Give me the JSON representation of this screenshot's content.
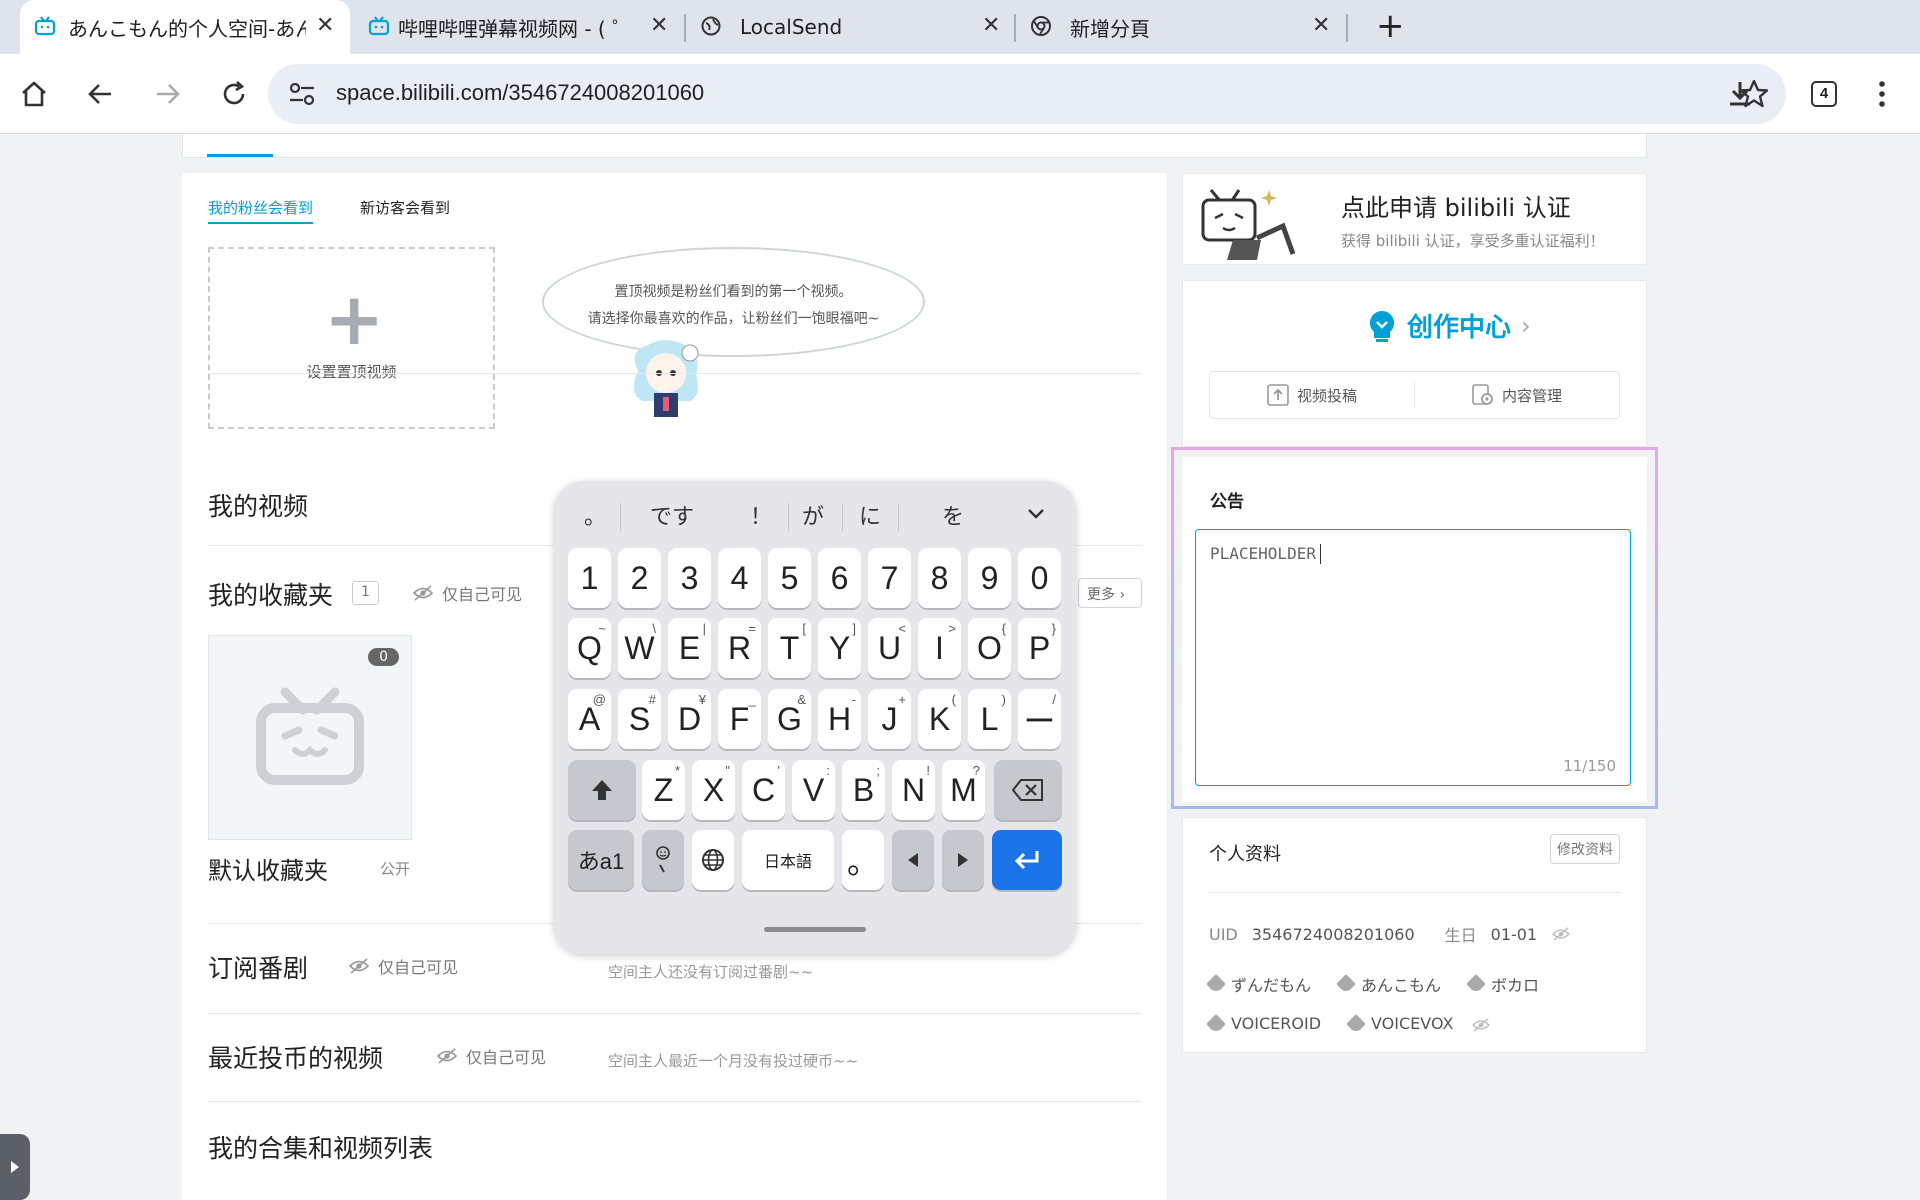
{
  "browser": {
    "tabs": [
      {
        "title": "あんこもん的个人空间-あんこ",
        "active": true
      },
      {
        "title": "哔哩哔哩弹幕视频网 - ( ゜- ゜",
        "active": false
      },
      {
        "title": "LocalSend",
        "active": false
      },
      {
        "title": "新增分頁",
        "active": false
      }
    ],
    "url": "space.bilibili.com/3546724008201060",
    "extensions_count": "4"
  },
  "pinned": {
    "tabs": [
      "我的粉丝会看到",
      "新访客会看到"
    ],
    "set_label": "设置置顶视频",
    "bubble_line1": "置顶视频是粉丝们看到的第一个视频。",
    "bubble_line2": "请选择你最喜欢的作品，让粉丝们一饱眼福吧~"
  },
  "sections": {
    "my_videos": "我的视频",
    "favorites": "我的收藏夹",
    "favorites_count": "1",
    "self_only": "仅自己可见",
    "more": "更多",
    "fav_folder_name": "默认收藏夹",
    "fav_folder_count": "0",
    "fav_folder_public": "公开",
    "bangumi": "订阅番剧",
    "bangumi_empty": "空间主人还没有订阅过番剧~~",
    "coins": "最近投币的视频",
    "coins_empty": "空间主人最近一个月没有投过硬币~~",
    "collections": "我的合集和视频列表"
  },
  "cert": {
    "title": "点此申请 bilibili 认证",
    "subtitle": "获得 bilibili 认证，享受多重认证福利！"
  },
  "creator": {
    "title": "创作中心",
    "upload": "视频投稿",
    "manage": "内容管理"
  },
  "notice": {
    "title": "公告",
    "value": "PLACEHOLDER",
    "count": "11/150"
  },
  "profile": {
    "title": "个人资料",
    "edit": "修改资料",
    "uid_label": "UID",
    "uid": "3546724008201060",
    "birthday_label": "生日",
    "birthday": "01-01",
    "tags": [
      "ずんだもん",
      "あんこもん",
      "ボカロ",
      "VOICEROID",
      "VOICEVOX"
    ]
  },
  "keyboard": {
    "candidates": [
      "。",
      "です",
      "！",
      "が",
      "に",
      "を"
    ],
    "row_numbers": [
      "1",
      "2",
      "3",
      "4",
      "5",
      "6",
      "7",
      "8",
      "9",
      "0"
    ],
    "row_q": [
      [
        "Q",
        "~"
      ],
      [
        "W",
        "\\"
      ],
      [
        "E",
        "|"
      ],
      [
        "R",
        "="
      ],
      [
        "T",
        "["
      ],
      [
        "Y",
        "]"
      ],
      [
        "U",
        "<"
      ],
      [
        "I",
        ">"
      ],
      [
        "O",
        "{"
      ],
      [
        "P",
        "}"
      ]
    ],
    "row_a": [
      [
        "A",
        "@"
      ],
      [
        "S",
        "#"
      ],
      [
        "D",
        "¥"
      ],
      [
        "F",
        "_"
      ],
      [
        "G",
        "&"
      ],
      [
        "H",
        "-"
      ],
      [
        "J",
        "+"
      ],
      [
        "K",
        "("
      ],
      [
        "L",
        ")"
      ],
      [
        "ー",
        "/"
      ]
    ],
    "row_z": [
      [
        "Z",
        "*"
      ],
      [
        "X",
        "\""
      ],
      [
        "C",
        "'"
      ],
      [
        "V",
        ":"
      ],
      [
        "B",
        ";"
      ],
      [
        "N",
        "!"
      ],
      [
        "M",
        "?"
      ]
    ],
    "mode_key": "あa1",
    "space_label": "日本語",
    "period": "。"
  },
  "colors": {
    "accent": "#00a1d6",
    "enter": "#1a73e8"
  }
}
